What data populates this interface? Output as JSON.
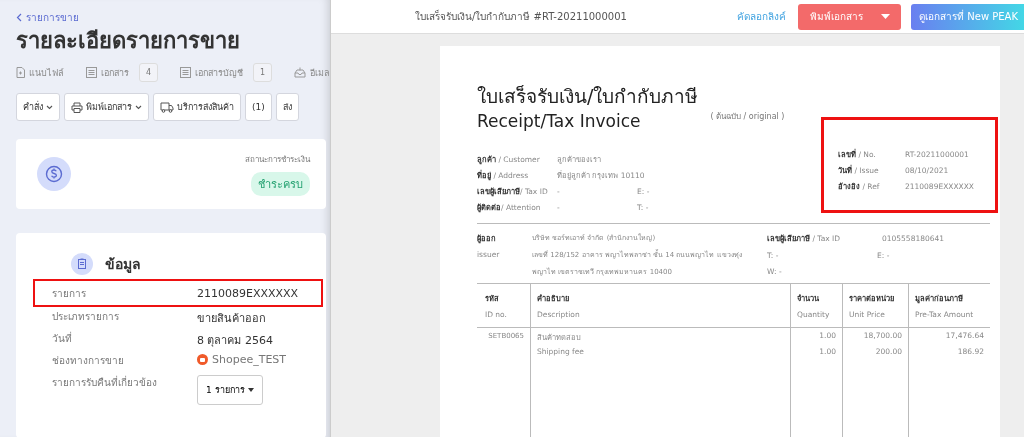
{
  "left": {
    "back_link": "รายการขาย",
    "title": "รายละเอียดรายการขาย",
    "tabs": [
      {
        "label": "แนบไฟล์",
        "kind": "file"
      },
      {
        "label": "เอกสาร",
        "count": "4",
        "kind": "doc"
      },
      {
        "label": "เอกสารบัญชี",
        "count": "1",
        "kind": "doc"
      },
      {
        "label": "อีเมล",
        "kind": "mail"
      }
    ],
    "actions": [
      {
        "label": "คำสั่ง",
        "kind": "dropdown"
      },
      {
        "label": "พิมพ์เอกสาร",
        "kind": "print"
      },
      {
        "label": "บริการส่งสินค้า",
        "kind": "truck"
      },
      {
        "label": "(1)",
        "kind": "plain"
      },
      {
        "label": "ส่ง",
        "kind": "plain"
      }
    ],
    "payment": {
      "label": "สถานะการชำระเงิน",
      "status": "ชำระครบ"
    },
    "info": {
      "title": "ข้อมูล",
      "rows": [
        {
          "label": "รายการ",
          "value": "2110089EXXXXXX",
          "kind": "text",
          "highlighted": true
        },
        {
          "label": "ประเภทรายการ",
          "value": "ขายสินค้าออก",
          "kind": "text",
          "highlighted": false
        },
        {
          "label": "วันที่",
          "value": "8 ตุลาคม 2564",
          "kind": "text",
          "highlighted": false
        },
        {
          "label": "ช่องทางการขาย",
          "value": "Shopee_TEST",
          "kind": "channel",
          "highlighted": false
        },
        {
          "label": "รายการรับคืนที่เกี่ยวข้อง",
          "value": "1 รายการ",
          "kind": "dropdown",
          "highlighted": false
        }
      ]
    }
  },
  "viewer": {
    "title": "ใบเสร็จรับเงิน/ใบกำกับภาษี #RT-20211000001",
    "copy_link": "คัดลอกลิงค์",
    "print_button": "พิมพ์เอกสาร",
    "peak_button": "ดูเอกสารที่ New PEAK"
  },
  "document": {
    "title_th": "ใบเสร็จรับเงิน/ใบกำกับภาษี",
    "title_en": "Receipt/Tax Invoice",
    "copy_note": "( ต้นฉบับ / original )",
    "customer": [
      {
        "label": "**ลูกค้า** / Customer",
        "value": "ลูกค้าของเรา"
      },
      {
        "label": "**ที่อยู่** / Address",
        "value": "ที่อยู่ลูกค้า กรุงเทพ 10110"
      },
      {
        "label": "**เลขผู้เสียภาษี**/ Tax ID",
        "value": "-",
        "extra": "E: -"
      },
      {
        "label": "**ผู้ติดต่อ**/ Attention",
        "value": "-",
        "extra": "T: -"
      }
    ],
    "meta_highlighted": true,
    "meta": [
      {
        "label": "**เลขที่** / No.",
        "value": "RT-20211000001"
      },
      {
        "label": "**วันที่** / Issue",
        "value": "08/10/2021"
      },
      {
        "label": "**อ้างอิง** / Ref",
        "value": "2110089EXXXXXX"
      }
    ],
    "issuer": {
      "label": "ผู้ออก",
      "label_en": "issuer",
      "lines": [
        "บริษัท ชอร์ทเอาท์ จำกัด (สำนักงานใหญ่)",
        "เลขที่ 128/152 อาคาร พญาไทพลาซ่า ชั้น 14 ถนนพญาไท แขวงทุ่ง",
        "พญาไท เขตราชเทวี กรุงเทพมหานคร 10400"
      ],
      "tax_label": "**เลขผู้เสียภาษี** / Tax ID",
      "tax_id": "0105558180641",
      "phone": "T: -",
      "email": "E: -",
      "web": "W: -"
    },
    "table": {
      "columns": [
        {
          "th": "รหัส",
          "en": "ID no."
        },
        {
          "th": "คำอธิบาย",
          "en": "Description"
        },
        {
          "th": "จำนวน",
          "en": "Quantity"
        },
        {
          "th": "ราคาต่อหน่วย",
          "en": "Unit Price"
        },
        {
          "th": "มูลค่าก่อนภาษี",
          "en": "Pre-Tax Amount"
        }
      ],
      "rows": [
        {
          "code": "SETB0065",
          "description": "สินค้าทดสอบ",
          "quantity": "1.00",
          "unit_price": "18,700.00",
          "amount": "17,476.64"
        },
        {
          "description": "Shipping fee",
          "quantity": "1.00",
          "unit_price": "200.00",
          "amount": "186.92"
        }
      ]
    }
  }
}
